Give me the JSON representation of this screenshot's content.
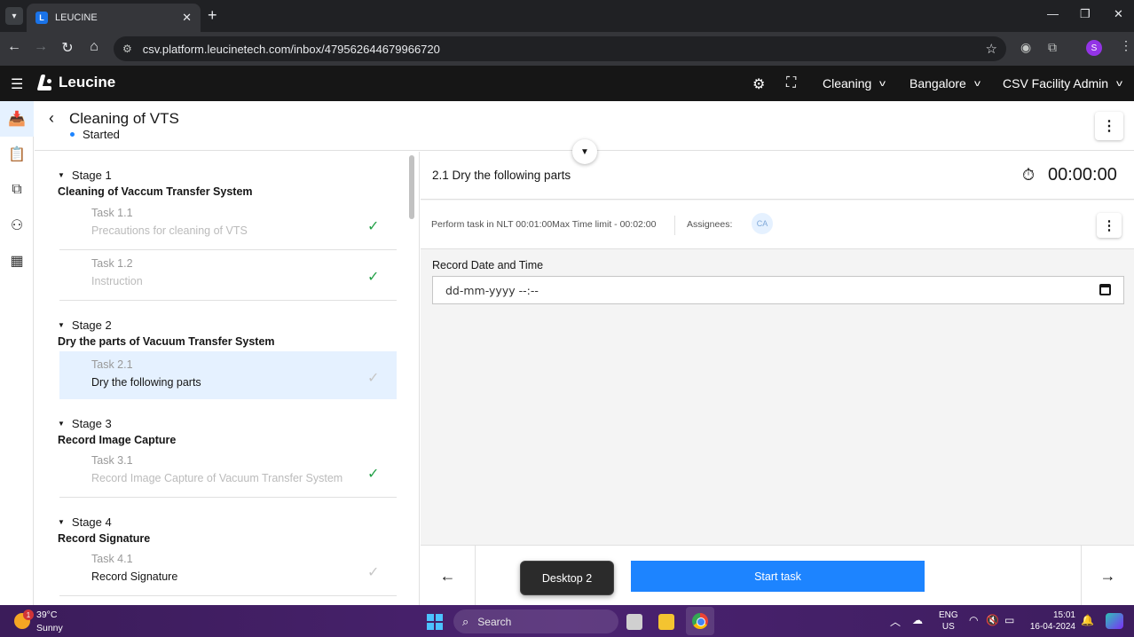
{
  "browser": {
    "tab_title": "LEUCINE",
    "url": "csv.platform.leucinetech.com/inbox/479562644679966720",
    "profile_initial": "S"
  },
  "app": {
    "brand": "Leucine",
    "use_case": "Cleaning",
    "facility": "Bangalore",
    "role": "CSV Facility Admin"
  },
  "page": {
    "title": "Cleaning of VTS",
    "status": "Started"
  },
  "stages": [
    {
      "label": "Stage 1",
      "name": "Cleaning of Vaccum Transfer System",
      "tasks": [
        {
          "num": "Task 1.1",
          "name": "Precautions for cleaning of VTS"
        },
        {
          "num": "Task 1.2",
          "name": "Instruction"
        }
      ]
    },
    {
      "label": "Stage 2",
      "name": "Dry the parts of Vacuum Transfer System",
      "tasks": [
        {
          "num": "Task 2.1",
          "name": "Dry the following parts"
        }
      ]
    },
    {
      "label": "Stage 3",
      "name": "Record Image Capture",
      "tasks": [
        {
          "num": "Task 3.1",
          "name": "Record Image Capture of Vacuum Transfer System"
        }
      ]
    },
    {
      "label": "Stage 4",
      "name": "Record Signature",
      "tasks": [
        {
          "num": "Task 4.1",
          "name": "Record Signature"
        }
      ]
    }
  ],
  "task_detail": {
    "heading": "2.1 Dry the following parts",
    "timer": "00:00:00",
    "timing_info": "Perform task in NLT 00:01:00Max Time limit - 00:02:00",
    "assignees_label": "Assignees:",
    "assignee_initials": "CA",
    "parameter_label": "Record Date and Time",
    "date_placeholder": "dd-mm-yyyy --:--"
  },
  "footer": {
    "start_label": "Start task",
    "tooltip": "Desktop 2"
  },
  "taskbar": {
    "temperature": "39°C",
    "condition": "Sunny",
    "weather_badge": "1",
    "search_label": "Search",
    "lang_line1": "ENG",
    "lang_line2": "US",
    "time": "15:01",
    "date": "16-04-2024"
  },
  "colors": {
    "accent": "#1d84ff",
    "check_green": "#24a148",
    "appbar": "#161616"
  }
}
